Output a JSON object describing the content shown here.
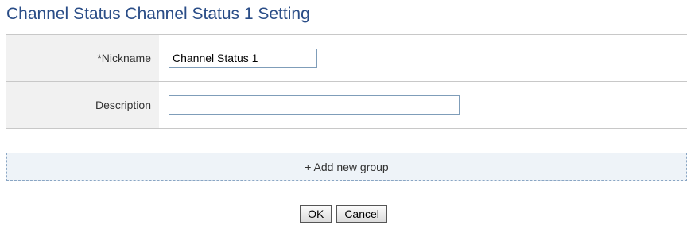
{
  "page": {
    "title": "Channel Status Channel Status 1 Setting"
  },
  "form": {
    "nickname_label": "*Nickname",
    "nickname_value": "Channel Status 1",
    "description_label": "Description",
    "description_value": ""
  },
  "groups": {
    "add_label": "+ Add new group"
  },
  "actions": {
    "ok_label": "OK",
    "cancel_label": "Cancel"
  },
  "colors": {
    "title": "#2a4d87",
    "label_bg": "#f1f1f1",
    "add_group_bg": "#eef3f8",
    "add_group_border": "#8aa6c4"
  }
}
